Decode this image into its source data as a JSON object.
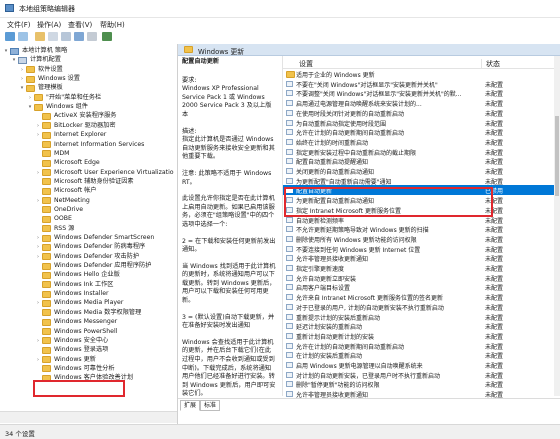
{
  "window": {
    "title": "本地组策略编辑器"
  },
  "menu": [
    "文件(F)",
    "操作(A)",
    "查看(V)",
    "帮助(H)"
  ],
  "tree": {
    "items": [
      {
        "label": "本地计算机 策略",
        "indent": 0,
        "twisty": "▾",
        "icon": "root"
      },
      {
        "label": "计算机配置",
        "indent": 1,
        "twisty": "▾",
        "icon": "pc"
      },
      {
        "label": "软件设置",
        "indent": 2,
        "twisty": "›",
        "icon": "folder"
      },
      {
        "label": "Windows 设置",
        "indent": 2,
        "twisty": "›",
        "icon": "folder"
      },
      {
        "label": "管理模板",
        "indent": 2,
        "twisty": "▾",
        "icon": "folder"
      },
      {
        "label": "\"开始\"菜单和任务栏",
        "indent": 3,
        "twisty": "›",
        "icon": "folder"
      },
      {
        "label": "Windows 组件",
        "indent": 3,
        "twisty": "▾",
        "icon": "folder"
      },
      {
        "label": "ActiveX 安装程序服务",
        "indent": 4,
        "twisty": "",
        "icon": "folder"
      },
      {
        "label": "BitLocker 驱动器加密",
        "indent": 4,
        "twisty": "›",
        "icon": "folder"
      },
      {
        "label": "Internet Explorer",
        "indent": 4,
        "twisty": "›",
        "icon": "folder"
      },
      {
        "label": "Internet Information Services",
        "indent": 4,
        "twisty": "",
        "icon": "folder"
      },
      {
        "label": "MDM",
        "indent": 4,
        "twisty": "",
        "icon": "folder"
      },
      {
        "label": "Microsoft Edge",
        "indent": 4,
        "twisty": "",
        "icon": "folder"
      },
      {
        "label": "Microsoft User Experience Virtualizatio",
        "indent": 4,
        "twisty": "›",
        "icon": "folder"
      },
      {
        "label": "Microsoft 辅助身份验证因素",
        "indent": 4,
        "twisty": "",
        "icon": "folder"
      },
      {
        "label": "Microsoft 帐户",
        "indent": 4,
        "twisty": "",
        "icon": "folder"
      },
      {
        "label": "NetMeeting",
        "indent": 4,
        "twisty": "›",
        "icon": "folder"
      },
      {
        "label": "OneDrive",
        "indent": 4,
        "twisty": "",
        "icon": "folder"
      },
      {
        "label": "OOBE",
        "indent": 4,
        "twisty": "",
        "icon": "folder"
      },
      {
        "label": "RSS 源",
        "indent": 4,
        "twisty": "",
        "icon": "folder"
      },
      {
        "label": "Windows Defender SmartScreen",
        "indent": 4,
        "twisty": "›",
        "icon": "folder"
      },
      {
        "label": "Windows Defender 防病毒程序",
        "indent": 4,
        "twisty": "›",
        "icon": "folder"
      },
      {
        "label": "Windows Defender 攻击防护",
        "indent": 4,
        "twisty": "›",
        "icon": "folder"
      },
      {
        "label": "Windows Defender 应用程序防护",
        "indent": 4,
        "twisty": "",
        "icon": "folder"
      },
      {
        "label": "Windows Hello 企业版",
        "indent": 4,
        "twisty": "",
        "icon": "folder"
      },
      {
        "label": "Windows Ink 工作区",
        "indent": 4,
        "twisty": "",
        "icon": "folder"
      },
      {
        "label": "Windows Installer",
        "indent": 4,
        "twisty": "",
        "icon": "folder"
      },
      {
        "label": "Windows Media Player",
        "indent": 4,
        "twisty": "›",
        "icon": "folder"
      },
      {
        "label": "Windows Media 数字权限管理",
        "indent": 4,
        "twisty": "",
        "icon": "folder"
      },
      {
        "label": "Windows Messenger",
        "indent": 4,
        "twisty": "",
        "icon": "folder"
      },
      {
        "label": "Windows PowerShell",
        "indent": 4,
        "twisty": "",
        "icon": "folder"
      },
      {
        "label": "Windows 安全中心",
        "indent": 4,
        "twisty": "›",
        "icon": "folder"
      },
      {
        "label": "Windows 登录选项",
        "indent": 4,
        "twisty": "",
        "icon": "folder"
      },
      {
        "label": "Windows 更新",
        "indent": 4,
        "twisty": "›",
        "icon": "folder"
      },
      {
        "label": "Windows 可靠性分析",
        "indent": 4,
        "twisty": "",
        "icon": "folder"
      },
      {
        "label": "Windows 客户体验改善计划",
        "indent": 4,
        "twisty": "",
        "icon": "folder"
      }
    ]
  },
  "pane": {
    "header": "Windows 更新",
    "desc_title": "配置自动更新",
    "desc_paragraphs": [
      "要求:\nWindows XP Professional Service Pack 1 或 Windows 2000 Service Pack 3 及以上版本",
      "描述:\n指定此计算机是否通过 Windows 自动更新服务来接收安全更新和其他重要下载。",
      "注意: 此策略不适用于 Windows RT。",
      "此设置允许你指定是否在此计算机上启用自动更新。如果已启用该服务，必须在\"组策略设置\"中的四个选项中选择一个:",
      "2 = 在下载和安装任何更新前发出通知。",
      "当 Windows 找到适用于此计算机的更新时，系统将通知用户可以下载更新。转到 Windows 更新后，用户可以下载和安装任何可用更新。",
      "3 = (默认设置)自动下载更新，并在准备好安装时发出通知",
      "Windows 会查找适用于此计算机的更新，并在后台下载它们(在此过程中，用户不会收到通知或受到中断)。下载完成后，系统将通知用户他们已经准备好进行安装。转到 Windows 更新后，用户即可安装它们。"
    ],
    "columns": {
      "setting": "设置",
      "state": "状态"
    },
    "policies": [
      {
        "name": "适用于企业的 Windows 更新",
        "state": "",
        "folder": true
      },
      {
        "name": "不要在\"关闭 Windows\"对话框显示\"安装更新并关机\"",
        "state": "未配置"
      },
      {
        "name": "不要调整\"关闭 Windows\"对话框显示\"安装更新并关机\"的默...",
        "state": "未配置"
      },
      {
        "name": "启用通过电源管理自动唤醒系统来安装计划的...",
        "state": "未配置"
      },
      {
        "name": "在使用时段关闭针对更新的自动重新启动",
        "state": "未配置"
      },
      {
        "name": "为自动重新启动指定使用时段范围",
        "state": "未配置"
      },
      {
        "name": "允许在计划的自动更新期间自动重新启动",
        "state": "未配置"
      },
      {
        "name": "始终在计划的时间重新启动",
        "state": "未配置"
      },
      {
        "name": "指定更新安装过程中自动重新启动的截止期限",
        "state": "未配置"
      },
      {
        "name": "配置自动重新启动提醒通知",
        "state": "未配置"
      },
      {
        "name": "关闭更新的自动重新启动通知",
        "state": "未配置"
      },
      {
        "name": "为更新配置\"自动重新启动需要\"通知",
        "state": "未配置"
      },
      {
        "name": "配置自动更新",
        "state": "已禁用",
        "selected": true
      },
      {
        "name": "为更新配置自动重新启动通知",
        "state": "未配置"
      },
      {
        "name": "指定 Intranet Microsoft 更新服务位置",
        "state": "未配置"
      },
      {
        "name": "自动更新检测频率",
        "state": "未配置"
      },
      {
        "name": "不允许更新延期策略导致对 Windows 更新的扫描",
        "state": "未配置"
      },
      {
        "name": "删除使用所有 Windows 更新功能的访问权限",
        "state": "未配置"
      },
      {
        "name": "不要连接到任何 Windows 更新 Internet 位置",
        "state": "未配置"
      },
      {
        "name": "允许非管理员接收更新通知",
        "state": "未配置"
      },
      {
        "name": "指定引擎更新速度",
        "state": "未配置"
      },
      {
        "name": "允许自动更新立即安装",
        "state": "未配置"
      },
      {
        "name": "启用客户端目标设置",
        "state": "未配置"
      },
      {
        "name": "允许来自 Intranet Microsoft 更新服务位置的签名更新",
        "state": "未配置"
      },
      {
        "name": "对于已登录的用户, 计划的自动更新安装不执行重新启动",
        "state": "未配置"
      },
      {
        "name": "重新提示计划的安装后重新启动",
        "state": "未配置"
      },
      {
        "name": "延迟计划安装的重新启动",
        "state": "未配置"
      },
      {
        "name": "重新计划自动更新计划的安装",
        "state": "未配置"
      },
      {
        "name": "允许在计划的自动更新期间自动重新启动",
        "state": "未配置"
      },
      {
        "name": "在计划的安装后重新启动",
        "state": "未配置"
      },
      {
        "name": "启用 Windows 更新电源管理以自动唤醒系统来",
        "state": "未配置"
      },
      {
        "name": "对计划的自动更新安装，已登录用户时不执行重新启动",
        "state": "未配置"
      },
      {
        "name": "删除\"暂停更新\"功能的访问权限",
        "state": "未配置"
      },
      {
        "name": "允许非管理员接收更新通知",
        "state": "未配置"
      }
    ],
    "tabs": [
      "扩展",
      "标准"
    ]
  },
  "status": {
    "text": "34 个设置"
  },
  "colors": {
    "selection": "#0078d7",
    "annotation": "#e0282e",
    "header": "#d7e4f2"
  }
}
